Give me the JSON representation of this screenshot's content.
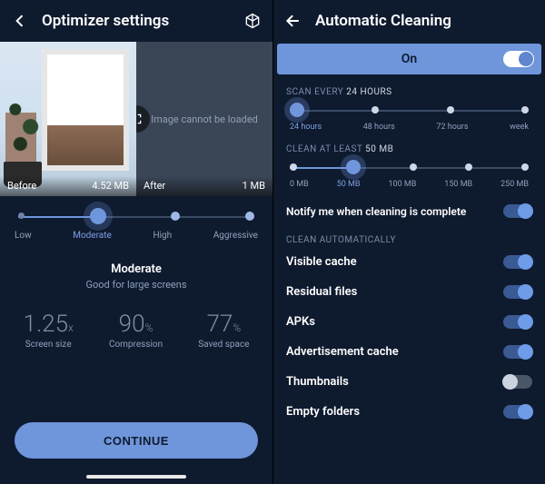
{
  "left": {
    "title": "Optimizer settings",
    "compare": {
      "before_label": "Before",
      "before_size": "4.52 MB",
      "after_label": "After",
      "after_size": "1 MB",
      "after_msg": "Image cannot be loaded"
    },
    "quality_slider": {
      "options": [
        "Low",
        "Moderate",
        "High",
        "Aggressive"
      ],
      "selected_index": 1
    },
    "description": {
      "title": "Moderate",
      "subtitle": "Good for large screens"
    },
    "stats": [
      {
        "value": "1.25",
        "unit": "x",
        "label": "Screen size"
      },
      {
        "value": "90",
        "unit": "%",
        "label": "Compression"
      },
      {
        "value": "77",
        "unit": "%",
        "label": "Saved space"
      }
    ],
    "cta": "CONTINUE"
  },
  "right": {
    "title": "Automatic Cleaning",
    "master_toggle": {
      "label": "On",
      "on": true
    },
    "scan": {
      "label_prefix": "SCAN EVERY",
      "label_value": "24 HOURS",
      "options": [
        "24 hours",
        "48 hours",
        "72 hours",
        "week"
      ],
      "selected_index": 0
    },
    "clean": {
      "label_prefix": "CLEAN AT LEAST",
      "label_value": "50 MB",
      "options": [
        "0 MB",
        "50 MB",
        "100 MB",
        "150 MB",
        "250 MB"
      ],
      "selected_index": 1
    },
    "notify": {
      "label": "Notify me when cleaning is complete",
      "on": true
    },
    "auto_section_label": "CLEAN AUTOMATICALLY",
    "auto_items": [
      {
        "label": "Visible cache",
        "on": true
      },
      {
        "label": "Residual files",
        "on": true
      },
      {
        "label": "APKs",
        "on": true
      },
      {
        "label": "Advertisement cache",
        "on": true
      },
      {
        "label": "Thumbnails",
        "on": false
      },
      {
        "label": "Empty folders",
        "on": true
      }
    ]
  }
}
